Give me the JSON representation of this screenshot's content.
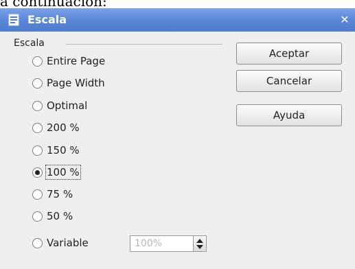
{
  "page_text_above": "a continuación:",
  "window": {
    "title": "Escala",
    "close_glyph": "✕"
  },
  "group": {
    "label": "Escala",
    "options": [
      {
        "label": "Entire Page",
        "checked": false
      },
      {
        "label": "Page Width",
        "checked": false
      },
      {
        "label": "Optimal",
        "checked": false
      },
      {
        "label": "200 %",
        "checked": false
      },
      {
        "label": "150 %",
        "checked": false
      },
      {
        "label": "100 %",
        "checked": true
      },
      {
        "label": "75 %",
        "checked": false
      },
      {
        "label": "50 %",
        "checked": false
      },
      {
        "label": "Variable",
        "checked": false
      }
    ],
    "variable_value": "100%"
  },
  "buttons": {
    "ok": "Aceptar",
    "cancel": "Cancelar",
    "help": "Ayuda"
  },
  "colors": {
    "titlebar": "#5a86d6",
    "dialog_bg": "#efefef"
  }
}
